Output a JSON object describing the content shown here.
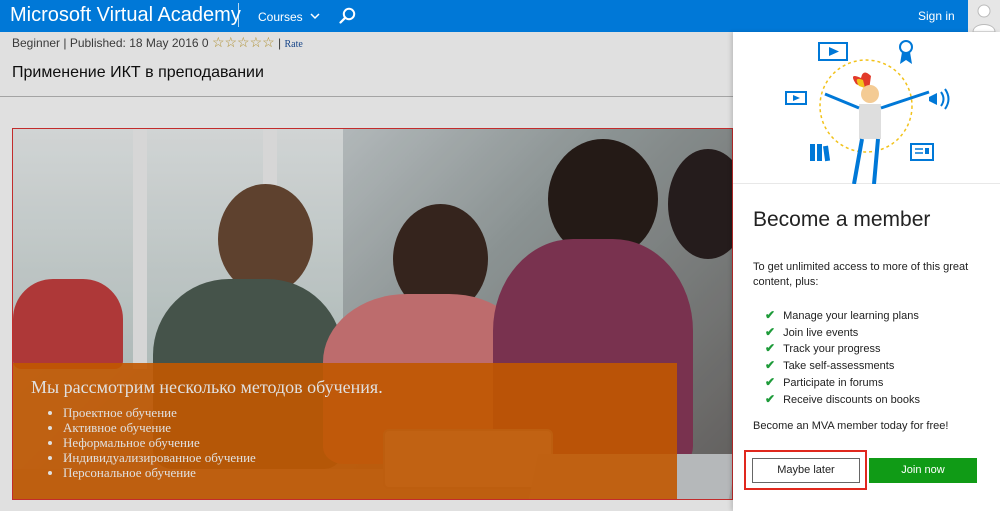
{
  "header": {
    "brand": "Microsoft Virtual Academy",
    "courses_label": "Courses",
    "signin_label": "Sign in",
    "brand_color": "#0078d7"
  },
  "course": {
    "meta": "Beginner | Published: 18 May 2016 0",
    "stars": "☆☆☆☆☆",
    "rate_label": "Rate",
    "title": "Применение ИКТ в преподавании"
  },
  "hero": {
    "heading": "Мы рассмотрим несколько методов обучения.",
    "methods": [
      "Проектное обучение",
      "Активное обучение",
      "Неформальное обучение",
      "Индивидуализированное обучение",
      "Персональное обучение"
    ],
    "overlay_color": "#dc6400"
  },
  "popup": {
    "title": "Become a member",
    "intro": "To get unlimited access to more of this great content, plus:",
    "benefits": [
      "Manage your learning plans",
      "Join live events",
      "Track your progress",
      "Take self-assessments",
      "Participate in forums",
      "Receive discounts on books"
    ],
    "cta": "Become an MVA member today for free!",
    "maybe_later": "Maybe later",
    "join_now": "Join now",
    "join_color": "#109b16"
  }
}
